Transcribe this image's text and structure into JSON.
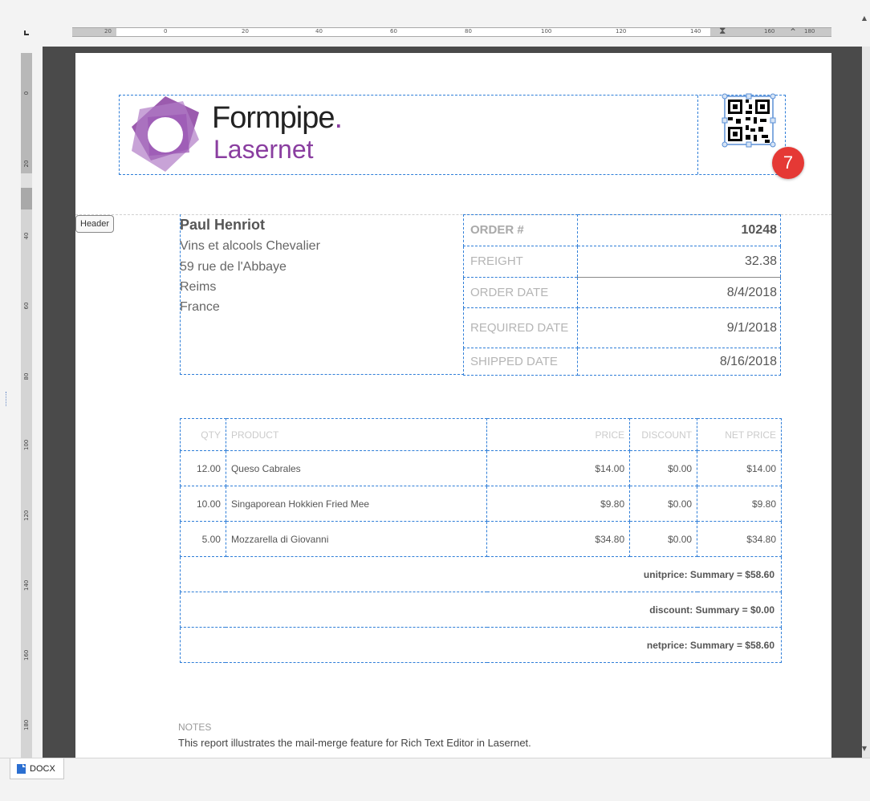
{
  "window": {
    "tab_label": "DOCX"
  },
  "ruler": {
    "h_numbers": [
      "20",
      "0",
      "20",
      "40",
      "60",
      "80",
      "100",
      "120",
      "140",
      "160",
      "180"
    ],
    "v_numbers": [
      "0",
      "20",
      "40",
      "60",
      "80",
      "100",
      "120",
      "140",
      "160",
      "180"
    ]
  },
  "logo": {
    "line1": "Formpipe",
    "dot": ".",
    "line2": "Lasernet"
  },
  "badge": {
    "count": "7"
  },
  "header_tag": "Header",
  "customer": {
    "name": "Paul Henriot",
    "company": "Vins et alcools Chevalier",
    "street": "59 rue de l'Abbaye",
    "city": "Reims",
    "country": "France"
  },
  "order": {
    "rows": [
      {
        "label": "ORDER #",
        "value": "10248"
      },
      {
        "label": "FREIGHT",
        "value": "32.38"
      },
      {
        "label": "ORDER DATE",
        "value": "8/4/2018"
      },
      {
        "label": "REQUIRED DATE",
        "value": "9/1/2018"
      },
      {
        "label": "SHIPPED DATE",
        "value": "8/16/2018"
      }
    ]
  },
  "items": {
    "headers": [
      "QTY",
      "PRODUCT",
      "PRICE",
      "DISCOUNT",
      "NET PRICE"
    ],
    "rows": [
      {
        "qty": "12.00",
        "product": "Queso Cabrales",
        "price": "$14.00",
        "discount": "$0.00",
        "net": "$14.00"
      },
      {
        "qty": "10.00",
        "product": "Singaporean Hokkien Fried Mee",
        "price": "$9.80",
        "discount": "$0.00",
        "net": "$9.80"
      },
      {
        "qty": "5.00",
        "product": "Mozzarella di Giovanni",
        "price": "$34.80",
        "discount": "$0.00",
        "net": "$34.80"
      }
    ],
    "summaries": [
      "unitprice: Summary = $58.60",
      "discount: Summary = $0.00",
      "netprice: Summary = $58.60"
    ]
  },
  "notes": {
    "title": "NOTES",
    "text": "This report illustrates the mail-merge feature for Rich Text Editor in Lasernet."
  },
  "colors": {
    "brand_purple": "#8a3ea0",
    "selection_blue": "#2f7ed8",
    "badge_red": "#e53935"
  }
}
